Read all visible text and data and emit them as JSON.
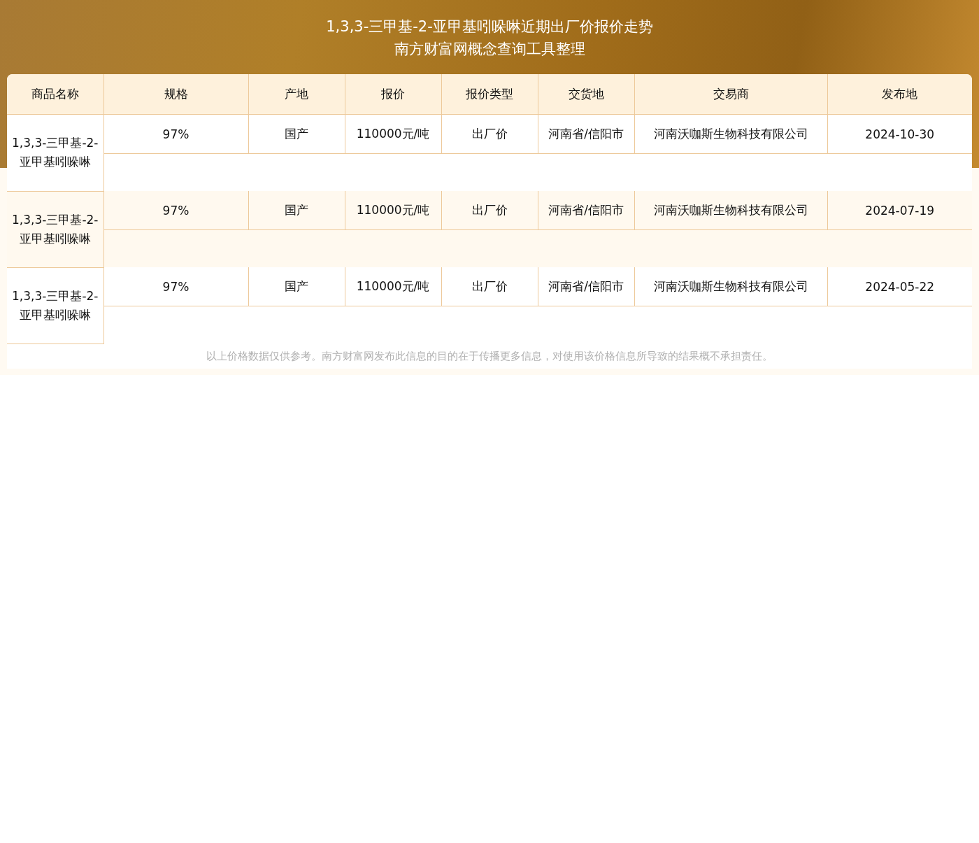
{
  "title": "1,3,3-三甲基-2-亚甲基吲哚啉近期出厂价报价走势",
  "subtitle": "南方财富网概念查询工具整理",
  "table": {
    "columns": [
      "商品名称",
      "规格",
      "产地",
      "报价",
      "报价类型",
      "交货地",
      "交易商",
      "发布地"
    ],
    "rows": [
      {
        "cells": [
          "1,3,3-三甲基-2-亚甲基吲哚啉",
          "97%",
          "国产",
          "110000元/吨",
          "出厂价",
          "河南省/信阳市",
          "河南沃咖斯生物科技有限公司",
          "2024-10-30"
        ]
      },
      {
        "cells": [
          "1,3,3-三甲基-2-亚甲基吲哚啉",
          "97%",
          "国产",
          "110000元/吨",
          "出厂价",
          "河南省/信阳市",
          "河南沃咖斯生物科技有限公司",
          "2024-07-19"
        ]
      },
      {
        "cells": [
          "1,3,3-三甲基-2-亚甲基吲哚啉",
          "97%",
          "国产",
          "110000元/吨",
          "出厂价",
          "河南省/信阳市",
          "河南沃咖斯生物科技有限公司",
          "2024-05-22"
        ]
      }
    ]
  },
  "disclaimer": "以上价格数据仅供参考。南方财富网发布此信息的目的在于传播更多信息，对使用该价格信息所导致的结果概不承担责任。"
}
